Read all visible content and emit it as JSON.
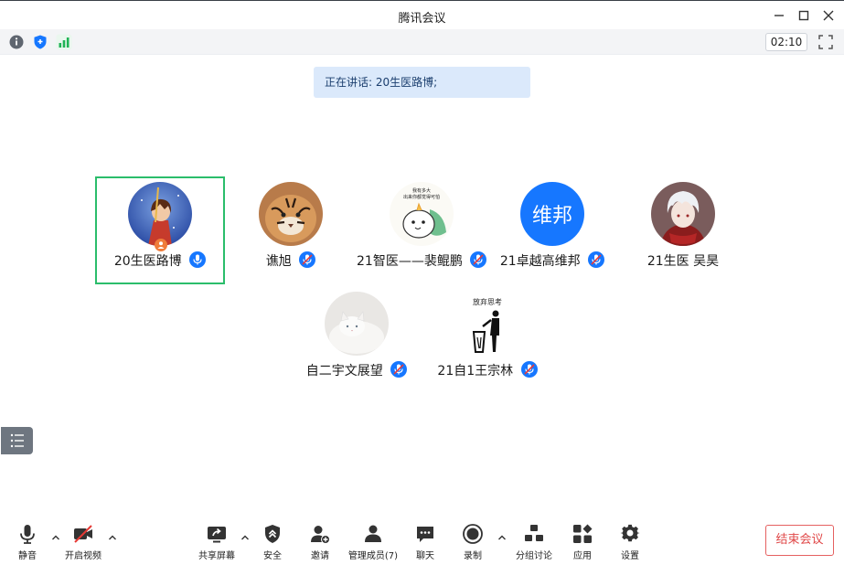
{
  "window": {
    "title": "腾讯会议"
  },
  "infobar": {
    "timer": "02:10"
  },
  "speaking": {
    "text": "正在讲话: 20生医路博;"
  },
  "participants": [
    {
      "name": "20生医路博",
      "active": true
    },
    {
      "name": "谯旭"
    },
    {
      "name": "21智医——裴鲲鹏"
    },
    {
      "name": "21卓越高维邦",
      "avatar_text": "维邦"
    },
    {
      "name": "21生医 吴昊"
    },
    {
      "name": "自二宇文展望"
    },
    {
      "name": "21自1王宗林",
      "avatar_text": "放弃思考"
    }
  ],
  "meme_avatar_text": "我有多大\n出来你都觉得可怕",
  "toolbar": {
    "mute": "静音",
    "video": "开启视频",
    "share": "共享屏幕",
    "security": "安全",
    "invite": "邀请",
    "members": "管理成员(7)",
    "chat": "聊天",
    "record": "录制",
    "breakout": "分组讨论",
    "apps": "应用",
    "settings": "设置",
    "end": "结束会议"
  },
  "colors": {
    "accent": "#1677ff",
    "active_border": "#2bbd6b",
    "end_red": "#e04848",
    "banner": "#dbe9fb"
  }
}
